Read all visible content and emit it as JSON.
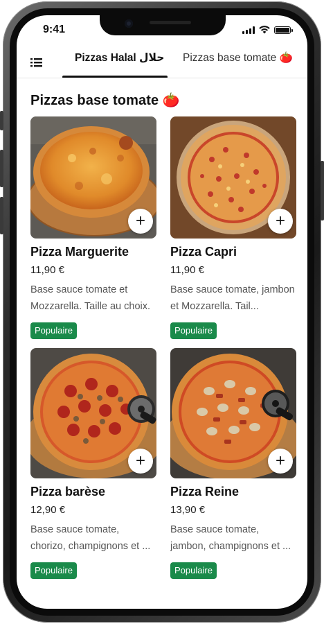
{
  "status_bar": {
    "time": "9:41"
  },
  "tabs": [
    {
      "label": "Pizzas Halal حلال",
      "active": true
    },
    {
      "label": "Pizzas base tomate 🍅",
      "active": false
    }
  ],
  "section": {
    "title": "Pizzas base tomate 🍅"
  },
  "products": [
    {
      "name": "Pizza Marguerite",
      "price": "11,90 €",
      "description": "Base sauce tomate et Mozzarella. Taille au choix.",
      "badge": "Populaire",
      "add_label": "+",
      "image": "pizza-margherita-photo"
    },
    {
      "name": "Pizza Capri",
      "price": "11,90 €",
      "description": "Base sauce tomate, jambon et Mozzarella. Tail...",
      "badge": "Populaire",
      "add_label": "+",
      "image": "pizza-capri-photo"
    },
    {
      "name": "Pizza barèse",
      "price": "12,90 €",
      "description": "Base sauce tomate, chorizo, champignons et ...",
      "badge": "Populaire",
      "add_label": "+",
      "image": "pizza-barese-photo"
    },
    {
      "name": "Pizza Reine",
      "price": "13,90 €",
      "description": "Base sauce tomate, jambon, champignons et ...",
      "badge": "Populaire",
      "add_label": "+",
      "image": "pizza-reine-photo"
    }
  ],
  "colors": {
    "badge_green": "#1a8a4a",
    "text_primary": "#111111",
    "text_secondary": "#555555"
  },
  "icons": {
    "menu": "list-menu-icon",
    "signal": "cellular-signal-icon",
    "wifi": "wifi-icon",
    "battery": "battery-icon",
    "add": "plus-icon"
  }
}
